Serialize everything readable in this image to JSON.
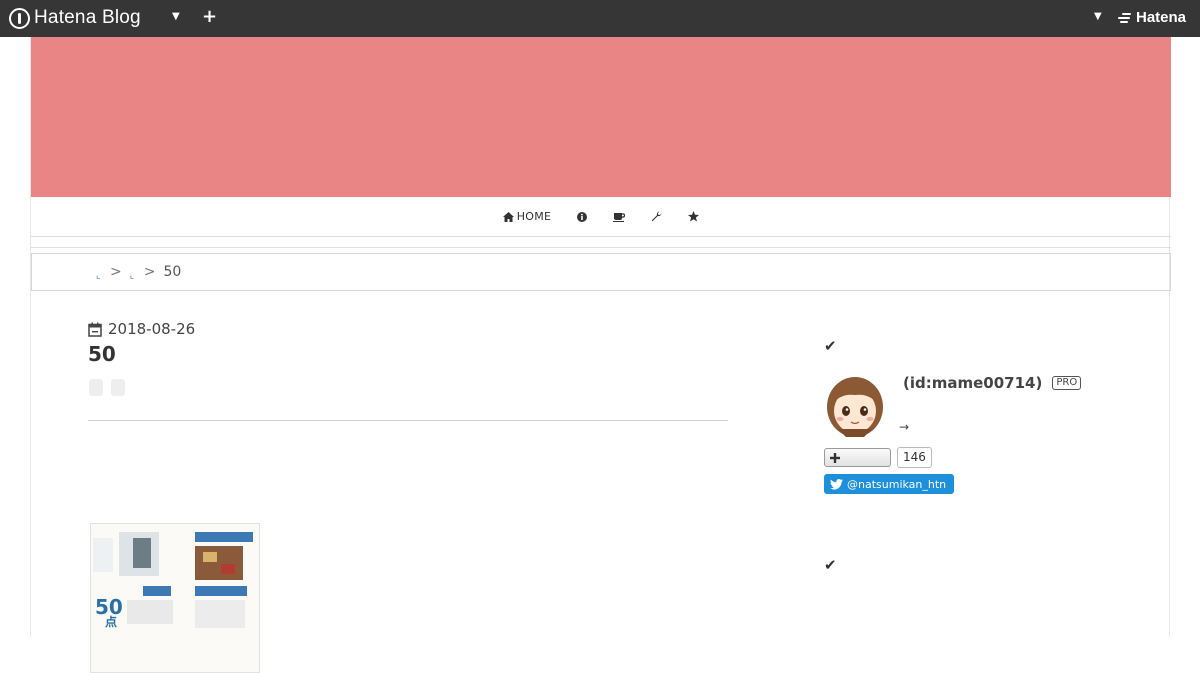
{
  "topbar": {
    "logo_text": "Hatena Blog",
    "brand_right": "Hatena"
  },
  "nav": {
    "items": [
      {
        "label": "HOME",
        "icon": "home-icon"
      },
      {
        "label": "",
        "icon": "info-icon"
      },
      {
        "label": "",
        "icon": "coffee-icon"
      },
      {
        "label": "",
        "icon": "wrench-icon"
      },
      {
        "label": "",
        "icon": "star-icon"
      }
    ]
  },
  "breadcrumb": {
    "sep": ">",
    "current": "50"
  },
  "article": {
    "date": "2018-08-26",
    "title": "50"
  },
  "sidebar": {
    "profile": {
      "id": "(id:mame00714)",
      "badge": "PRO",
      "description": "→"
    },
    "follow_count": "146",
    "twitter_handle": "@natsumikan_htn"
  },
  "colors": {
    "topbar": "#363636",
    "header_banner": "#e98584",
    "twitter": "#1d8fdb",
    "link": "#2a7ab8"
  }
}
